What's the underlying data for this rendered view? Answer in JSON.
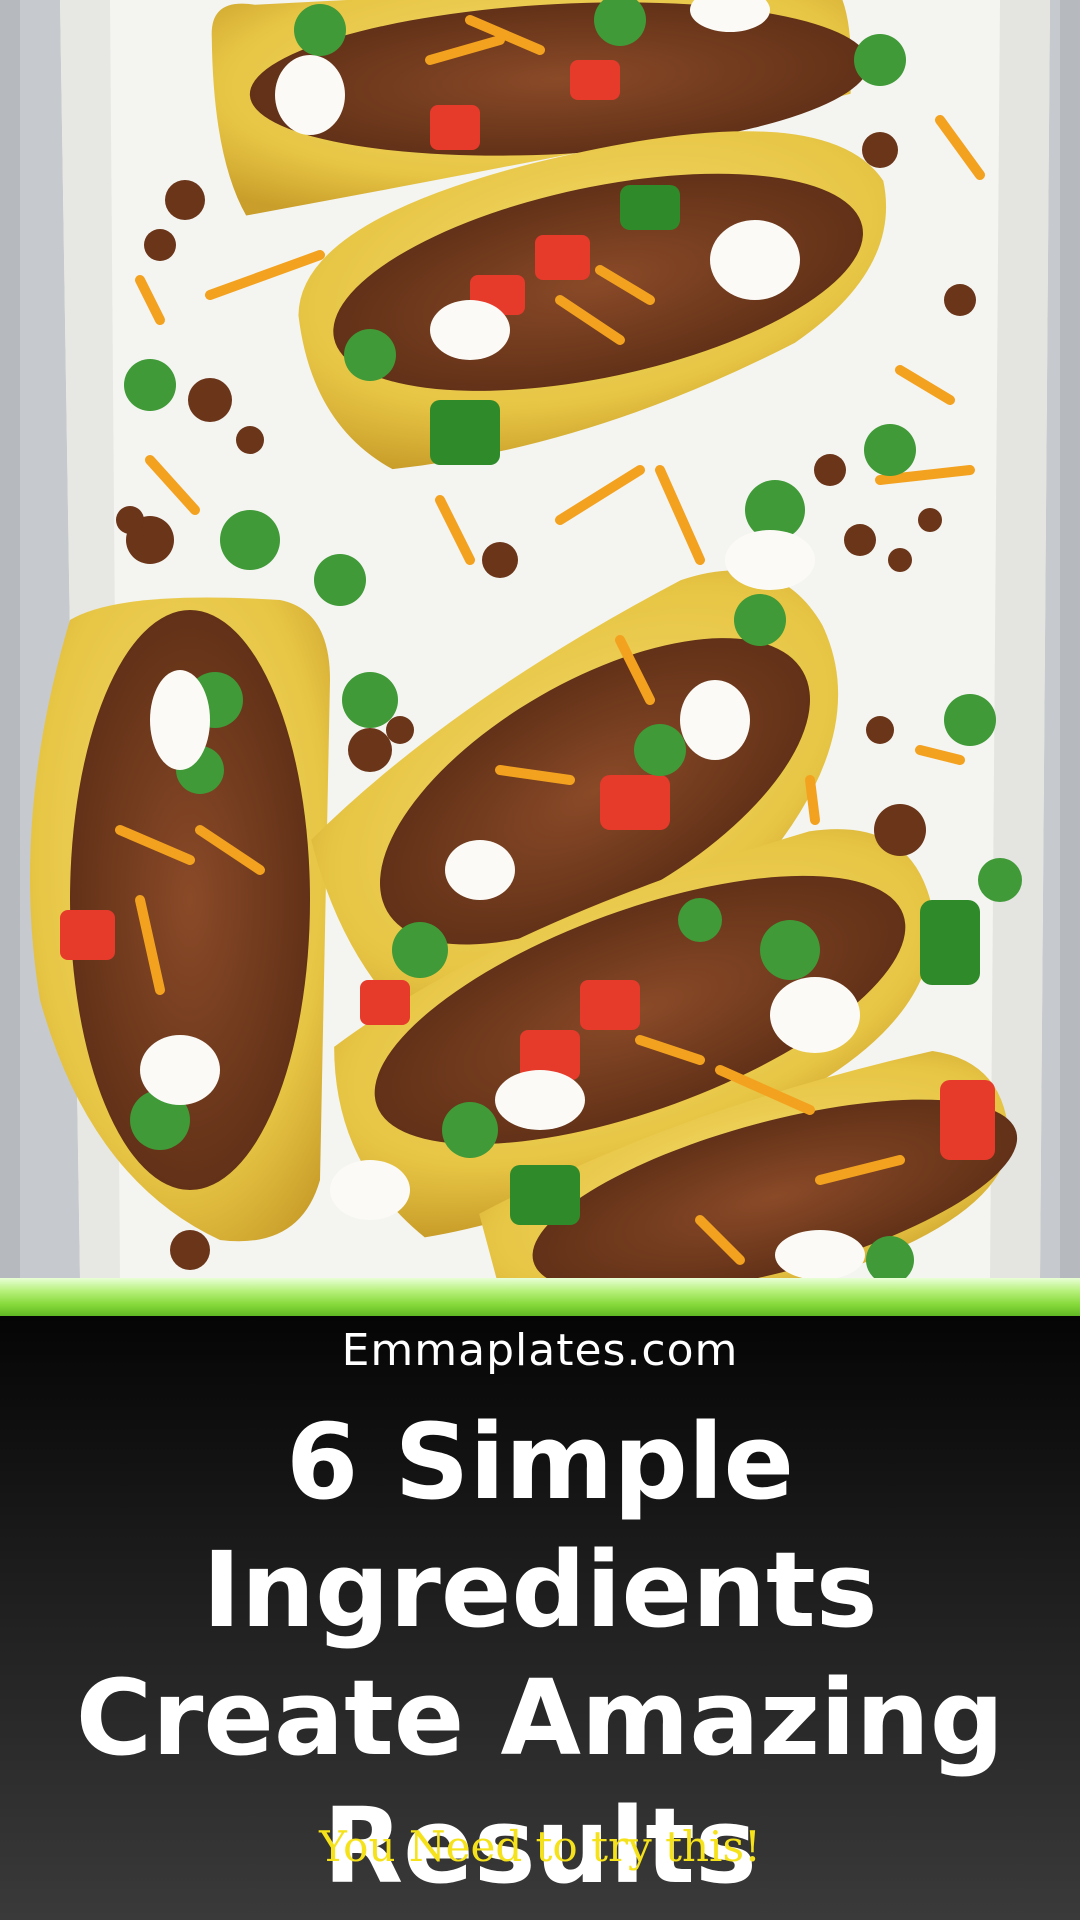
{
  "image": {
    "alt": "Crispy tacos with ground meat, shredded cheddar, tomato, cilantro and sour cream on a parchment-lined baking sheet"
  },
  "caption": {
    "site": "Emmaplates.com",
    "headline": "6 Simple Ingredients Create Amazing Results",
    "tagline": "You Need to try this!"
  },
  "colors": {
    "accent_bar": "#86d93a",
    "caption_background": "#1e1e1e",
    "headline": "#ffffff",
    "tagline": "#f5e21a"
  }
}
